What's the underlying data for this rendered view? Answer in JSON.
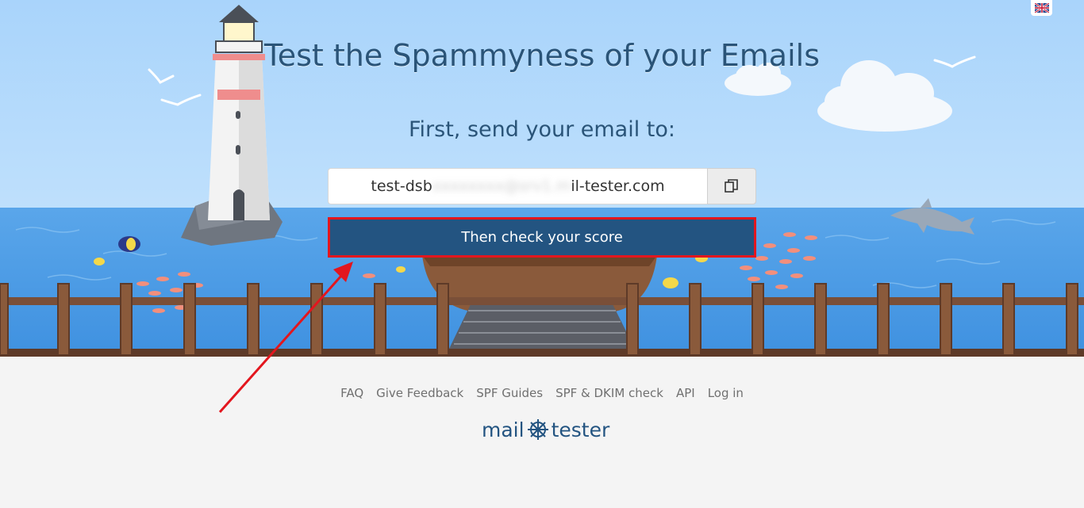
{
  "header": {
    "title": "Test the Spammyness of your Emails",
    "subtitle": "First, send your email to:"
  },
  "email": {
    "prefix": "test-dsb",
    "hidden": "xxxxxxxx@srv1.m",
    "suffix": "il-tester.com"
  },
  "actions": {
    "check_label": "Then check your score",
    "copy_icon": "copy-icon"
  },
  "language": {
    "icon": "uk-flag-icon"
  },
  "footer": {
    "links": [
      "FAQ",
      "Give Feedback",
      "SPF Guides",
      "SPF & DKIM check",
      "API",
      "Log in"
    ]
  },
  "logo": {
    "left": "mail",
    "right": "tester",
    "icon": "ships-wheel-icon"
  },
  "colors": {
    "brand": "#235481",
    "highlight": "#e3161e",
    "sky": "#a7d3fa",
    "sea": "#4e9fe8"
  }
}
